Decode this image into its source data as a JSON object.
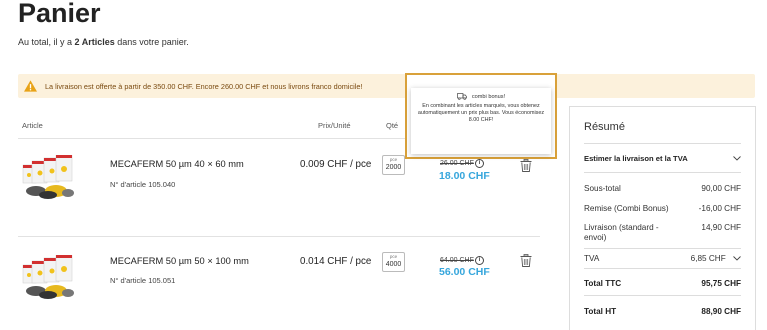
{
  "page": {
    "title": "Panier",
    "subtitle_prefix": "Au total, il y a ",
    "subtitle_count": "2 Articles",
    "subtitle_suffix": " dans votre panier."
  },
  "banner": {
    "text": "La livraison est offerte à partir de 350.00 CHF. Encore 260.00 CHF et nous livrons franco domicile!",
    "icon": "warning-icon",
    "color": "#fcf1dc"
  },
  "table": {
    "headers": {
      "article": "Article",
      "price": "Prix/Unité",
      "qty": "Qté"
    }
  },
  "tooltip": {
    "title": "combi bonus!",
    "body": "En combinant les articles marqués, vous obtenez automatiquement un prix plus bas. Vous économisez 8.00 CHF!",
    "icon": "truck-icon",
    "highlight_color": "#d9a13a"
  },
  "items": [
    {
      "name": "MECAFERM 50 µm 40 × 60 mm",
      "number": "N° d'article 105.040",
      "unit_price": "0.009 CHF / pce",
      "qty_unit": "pce",
      "qty": "2000",
      "old_price": "26.00 CHF",
      "new_price": "18.00 CHF"
    },
    {
      "name": "MECAFERM 50 µm 50 × 100 mm",
      "number": "N° d'article 105.051",
      "unit_price": "0.014 CHF / pce",
      "qty_unit": "pce",
      "qty": "4000",
      "old_price": "64.00 CHF",
      "new_price": "56.00 CHF"
    }
  ],
  "summary": {
    "title": "Résumé",
    "estimate_label": "Estimer la livraison et la TVA",
    "rows": [
      {
        "label": "Sous-total",
        "value": "90,00 CHF"
      },
      {
        "label": "Remise (Combi Bonus)",
        "value": "-16,00 CHF"
      },
      {
        "label": "Livraison (standard - envoi)",
        "value": "14,90 CHF"
      },
      {
        "label": "TVA",
        "value": "6,85 CHF"
      },
      {
        "label": "Total TTC",
        "value": "95,75 CHF"
      },
      {
        "label": "Total HT",
        "value": "88,90 CHF"
      }
    ]
  },
  "colors": {
    "accent_blue": "#36a6dc",
    "warning": "#e8a317"
  }
}
